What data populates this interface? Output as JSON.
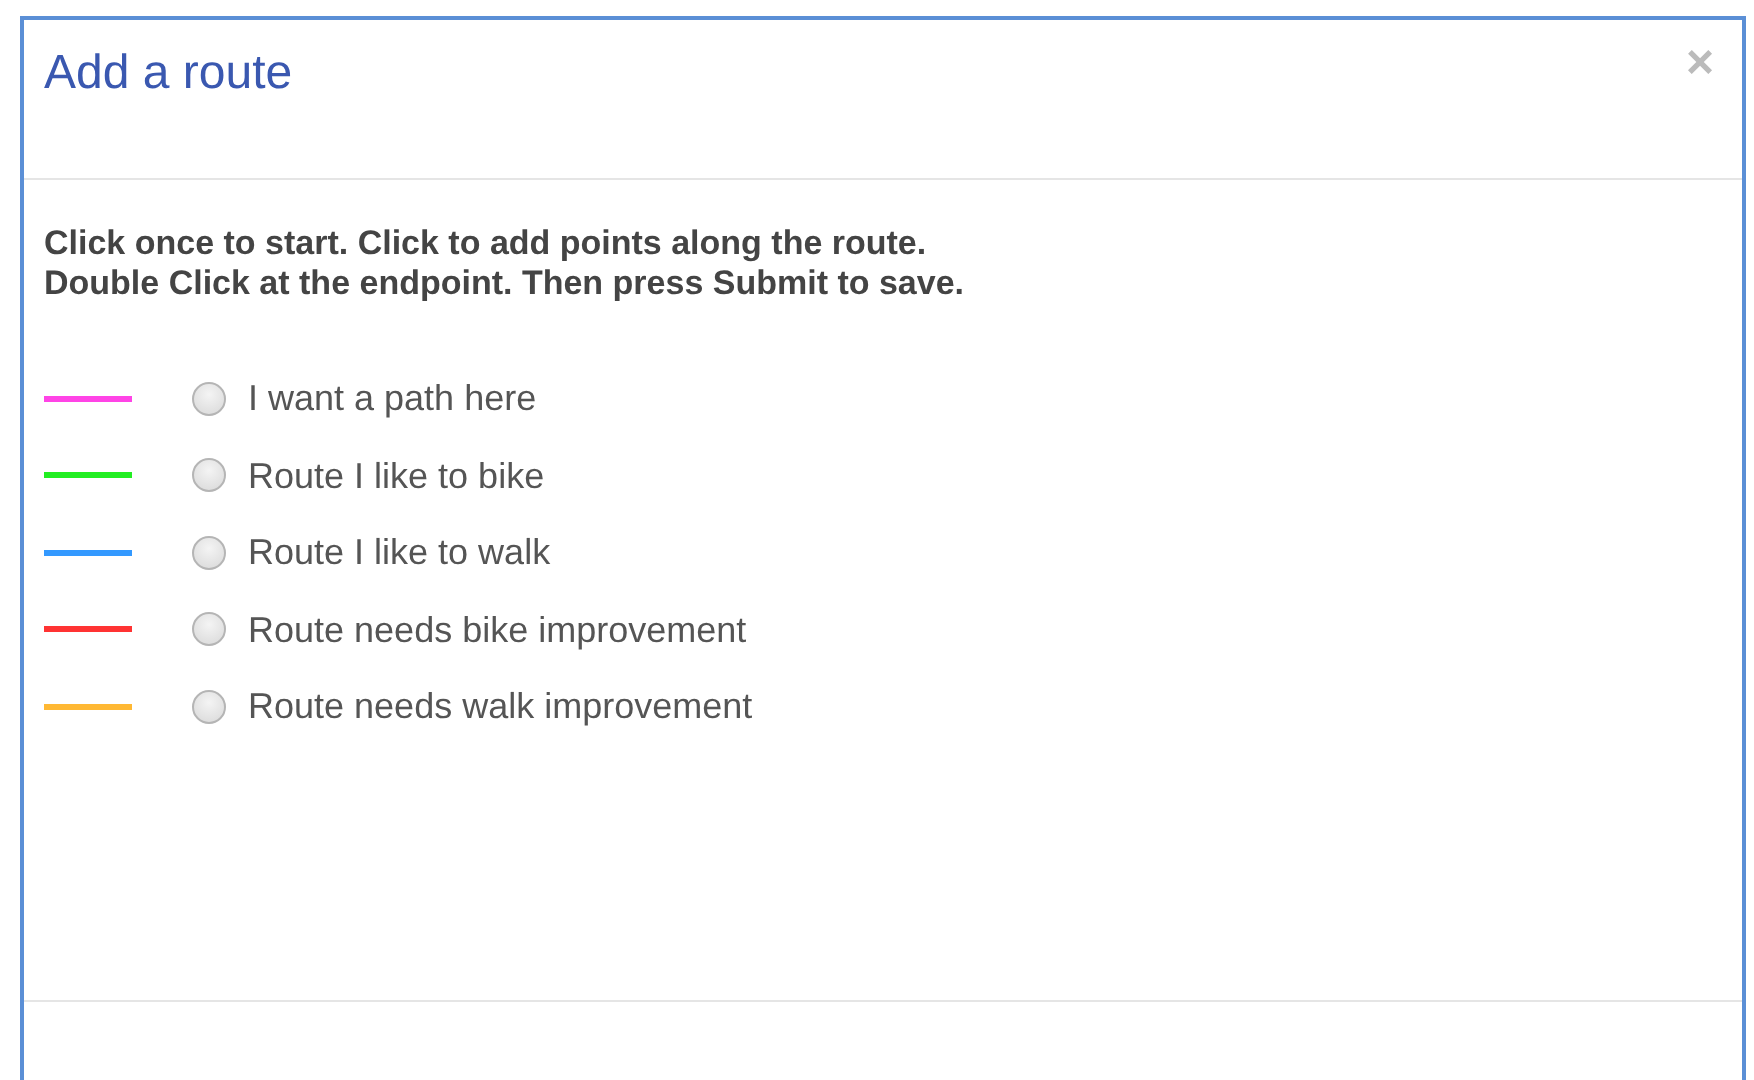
{
  "dialog": {
    "title": "Add a route",
    "close": "×"
  },
  "instructions": [
    "Click once to start. Click to add points along the route.",
    "Double Click at the endpoint. Then press Submit to save."
  ],
  "options": [
    {
      "label": "I want a path here",
      "color": "#ff44e6",
      "selected": false
    },
    {
      "label": "Route I like to bike",
      "color": "#22ee22",
      "selected": false
    },
    {
      "label": "Route I like to walk",
      "color": "#3399ff",
      "selected": false
    },
    {
      "label": "Route needs bike improvement",
      "color": "#ff3333",
      "selected": false
    },
    {
      "label": "Route needs walk improvement",
      "color": "#ffb833",
      "selected": false
    }
  ]
}
